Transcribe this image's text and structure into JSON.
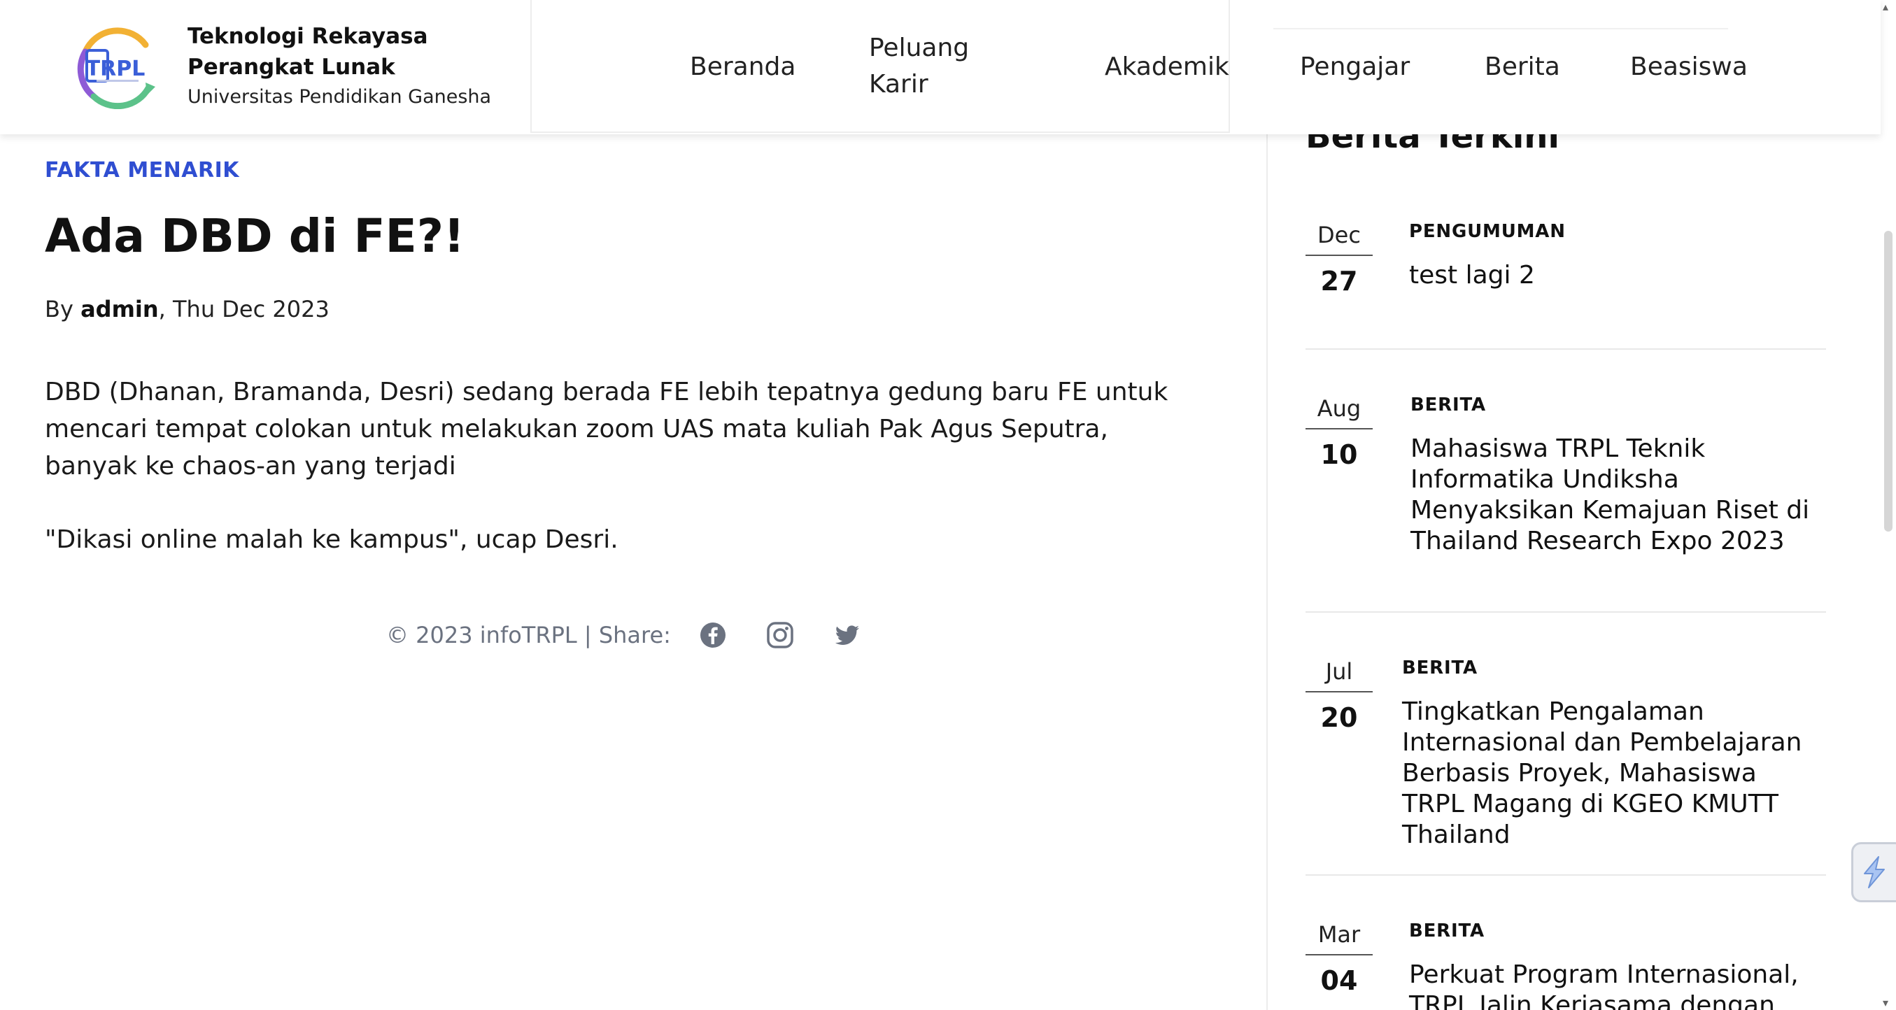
{
  "header": {
    "brand_title": "Teknologi Rekayasa Perangkat Lunak",
    "brand_subtitle": "Universitas Pendidikan Ganesha",
    "logo_text": "TRPL",
    "nav": [
      "Beranda",
      "Peluang Karir",
      "Akademik",
      "Pengajar",
      "Berita",
      "Beasiswa"
    ]
  },
  "article": {
    "category": "FAKTA MENARIK",
    "title": "Ada DBD di FE?!",
    "byline_prefix": "By ",
    "author": "admin",
    "date": ", Thu Dec 2023",
    "paragraphs": [
      "DBD (Dhanan, Bramanda, Desri) sedang berada FE lebih tepatnya gedung baru FE untuk mencari tempat colokan untuk melakukan zoom UAS mata kuliah Pak Agus Seputra, banyak ke chaos-an yang terjadi",
      "\"Dikasi online malah ke kampus\", ucap Desri."
    ],
    "footer_text": "© 2023 infoTRPL | Share:",
    "share_icons": [
      "facebook-icon",
      "instagram-icon",
      "twitter-icon"
    ]
  },
  "sidebar": {
    "heading": "Berita Terkini",
    "items": [
      {
        "month": "Dec",
        "day": "27",
        "category": "PENGUMUMAN",
        "title": "test lagi 2"
      },
      {
        "month": "Aug",
        "day": "10",
        "category": "BERITA",
        "title": "Mahasiswa TRPL Teknik Informatika Undiksha Menyaksikan Kemajuan Riset di Thailand Research Expo 2023"
      },
      {
        "month": "Jul",
        "day": "20",
        "category": "BERITA",
        "title": "Tingkatkan Pengalaman Internasional dan Pembelajaran Berbasis Proyek, Mahasiswa TRPL Magang di KGEO KMUTT Thailand"
      },
      {
        "month": "Mar",
        "day": "04",
        "category": "BERITA",
        "title": "Perkuat Program Internasional, TRPL Jalin Kerjasama dengan"
      }
    ]
  },
  "colors": {
    "category_blue": "#2f4ed1",
    "text": "#111111",
    "muted": "#6b7280"
  }
}
